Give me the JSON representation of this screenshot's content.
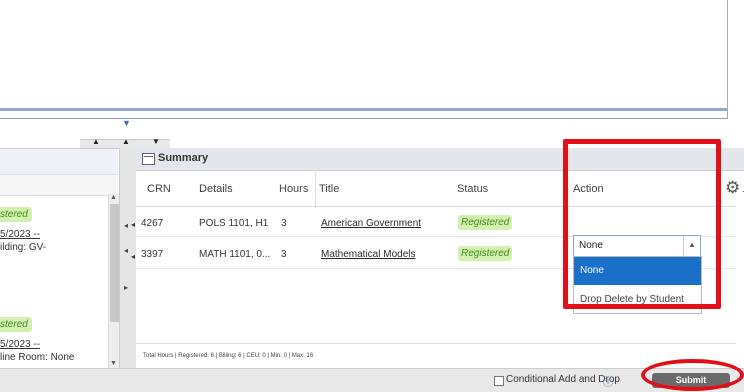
{
  "summary": {
    "title": "Summary",
    "columns": [
      "CRN",
      "Details",
      "Hours",
      "Title",
      "Status",
      "Action"
    ],
    "rows": [
      {
        "crn": "4267",
        "details": "POLS 1101, H1",
        "hours": "3",
        "title": "American Government",
        "status": "Registered",
        "action": "None"
      },
      {
        "crn": "3397",
        "details": "MATH 1101, 0...",
        "hours": "3",
        "title": "Mathematical Models",
        "status": "Registered"
      }
    ],
    "action_dropdown": {
      "selected": "None",
      "options": [
        "None",
        "Drop Delete by Student"
      ]
    },
    "totals": "Total Hours | Registered: 6 | Billing: 6 | CEU: 0 | Min: 0 | Max: 16"
  },
  "left_panel": {
    "block1": {
      "status": "stered",
      "date": "5/2023 --",
      "line2": "ilding: GV-"
    },
    "block2": {
      "status": "stered",
      "date": "5/2023 --",
      "line2": "line Room: None"
    }
  },
  "footer": {
    "conditional_label": "Conditional Add and Drop",
    "submit_label": "Submit"
  },
  "colors": {
    "highlight_red": "#e10f1a",
    "selected_option": "#1a6fc9",
    "registered_bg": "#d4f0b0"
  }
}
